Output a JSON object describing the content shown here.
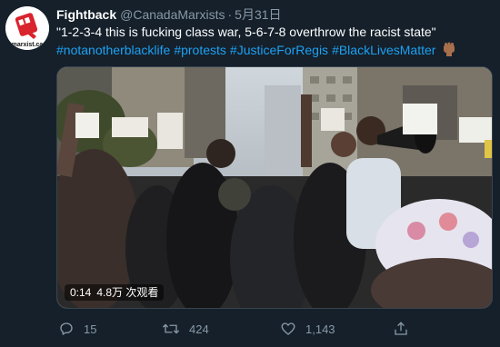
{
  "tweet": {
    "display_name": "Fightback",
    "handle": "@CanadaMarxists",
    "separator": "·",
    "date": "5月31日",
    "text": "\"1-2-3-4 this is fucking class war, 5-6-7-8 overthrow the racist state\"",
    "hashtags": [
      "#notanotherblacklife",
      "#protests",
      "#JusticeForRegis",
      "#BlackLivesMatter"
    ],
    "avatar_caption": "marxist.ca",
    "emoji": "raised-fist-icon"
  },
  "video": {
    "duration": "0:14",
    "views": "4.8万 次观看"
  },
  "actions": {
    "replies": "15",
    "retweets": "424",
    "likes": "1,143"
  },
  "colors": {
    "background": "#15202b",
    "link": "#1da1f2",
    "muted": "#8899a6"
  }
}
